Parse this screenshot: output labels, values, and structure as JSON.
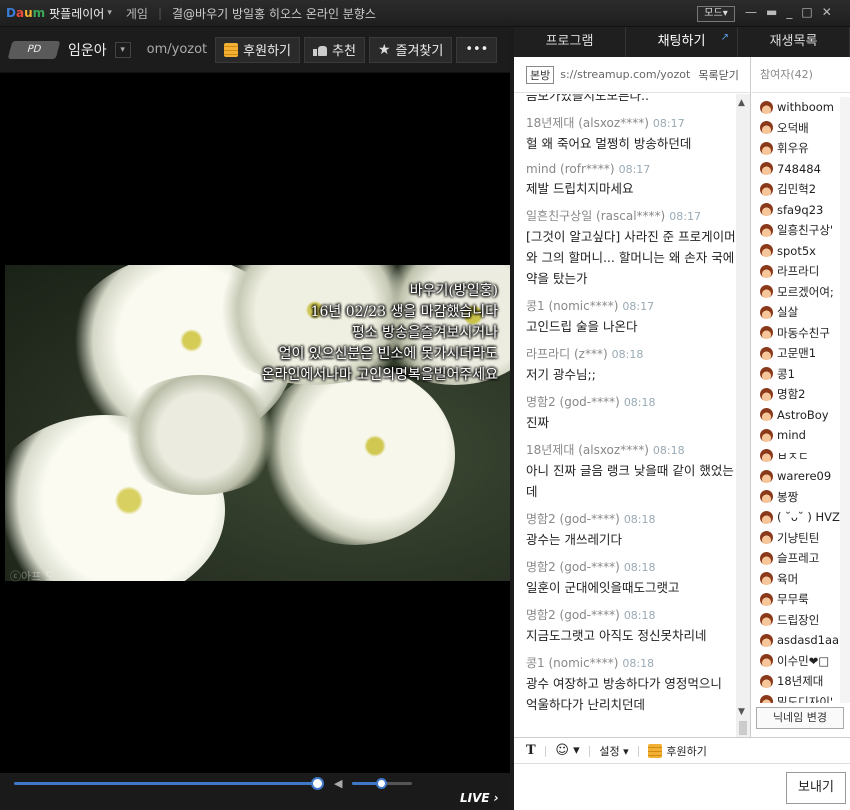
{
  "titlebar": {
    "logo": [
      "D",
      "a",
      "u",
      "m"
    ],
    "brand": "팟플레이어",
    "menu_game": "게임",
    "title": "결@바우기 방일홍 히오스 온라인 분향스",
    "mode_label": "모드",
    "controls": [
      "—",
      "▬",
      "_",
      "□",
      "✕"
    ]
  },
  "header": {
    "pd_badge": "PD",
    "bj_name": "임운아",
    "url": "om/yozot",
    "donate_label": "후원하기",
    "recommend_label": "추천",
    "favorite_label": "즐겨찾기",
    "more_label": "•••"
  },
  "video": {
    "caption": [
      "바우기(방일홍)",
      "16년 02/23 생을 마감했습니다",
      "평소 방송을즐겨보시거나",
      "얼이 있으신분은 빈소에 못가시더라도",
      "온라인에서나마 고인의명복을빌어주세요"
    ],
    "watermark": "ⓒ아프 도",
    "seek_progress": 0.97,
    "volume_level": 0.5,
    "live_label": "LIVE ›"
  },
  "tabs": [
    "프로그램",
    "채팅하기",
    "재생목록"
  ],
  "broadcast": {
    "tag": "본방",
    "url": "s://streamup.com/yozot",
    "close": "목록닫기"
  },
  "chat": {
    "first_line": "음보가있을지도모른다..",
    "messages": [
      {
        "who": "18년제대 (alsxoz****)",
        "time": "08:17",
        "text": "헐 왜 죽어요 멀쩡히 방송하던데"
      },
      {
        "who": "mind (rofr****)",
        "time": "08:17",
        "text": "제발 드립치지마세요"
      },
      {
        "who": "일흔친구상일 (rascal****)",
        "time": "08:17",
        "text": "[그것이 알고싶다] 사라진 준 프로게이머와 그의 할머니... 할머니는 왜 손자 국에 약을 탔는가"
      },
      {
        "who": "콩1 (nomic****)",
        "time": "08:17",
        "text": "고인드립 술을 나온다"
      },
      {
        "who": "라프라디 (z***)",
        "time": "08:18",
        "text": "저기 광수님;;"
      },
      {
        "who": "명함2 (god-****)",
        "time": "08:18",
        "text": "진짜"
      },
      {
        "who": "18년제대 (alsxoz****)",
        "time": "08:18",
        "text": "아니 진짜 글음 랭크 낮을때 같이 했었는데"
      },
      {
        "who": "명함2 (god-****)",
        "time": "08:18",
        "text": "광수는 개쓰레기다"
      },
      {
        "who": "명함2 (god-****)",
        "time": "08:18",
        "text": "일훈이 군대에잇을때도그랫고"
      },
      {
        "who": "명함2 (god-****)",
        "time": "08:18",
        "text": "지금도그랫고 아직도 정신못차리네"
      },
      {
        "who": "콩1 (nomic****)",
        "time": "08:18",
        "text": "광수 여장하고 방송하다가 영정먹으니 억울하다가 난리치던데"
      }
    ]
  },
  "participants": {
    "header": "참여자(42)",
    "list": [
      "withboom",
      "오덕배",
      "휘우유",
      "748484",
      "김민혁2",
      "sfa9q23",
      "일흥친구상'",
      "spot5x",
      "라프라디",
      "모르겠어여;",
      "실살",
      "마동수친구",
      "고문맨1",
      "콩1",
      "명함2",
      "AstroBoy",
      "mind",
      "ㅂㅈㄷ",
      "warere09",
      "봉짱",
      "( ˘ᴗ˘ ) HVZ",
      "기냥틴틴",
      "슬프레고",
      "육머",
      "무무룩",
      "드립장인",
      "asdasd1aa",
      "이수민❤□",
      "18년제대",
      "밀도디자이'"
    ],
    "nick_change": "닉네임 변경"
  },
  "toolbar": {
    "bold": "T",
    "emoji": "☺",
    "settings": "설정",
    "donate": "후원하기"
  },
  "send_label": "보내기"
}
